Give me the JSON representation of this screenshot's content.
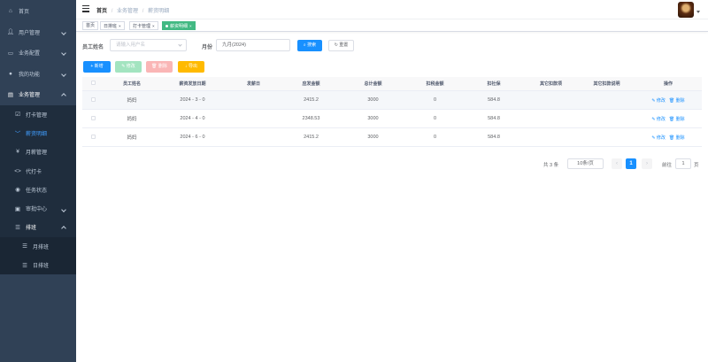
{
  "sidebar": {
    "items": [
      {
        "label": "首页",
        "icon": "dashboard-icon"
      },
      {
        "label": "用户管理",
        "icon": "user-icon"
      },
      {
        "label": "业务配置",
        "icon": "monitor-icon"
      },
      {
        "label": "我的功能",
        "icon": "person-icon"
      },
      {
        "label": "业务管理",
        "icon": "business-icon"
      }
    ],
    "sub": [
      {
        "label": "打卡管理",
        "icon": "checkbox-icon"
      },
      {
        "label": "薪资明细",
        "icon": "chevron-icon"
      },
      {
        "label": "月薪管理",
        "icon": "yen-icon"
      },
      {
        "label": "代打卡",
        "icon": "code-icon"
      },
      {
        "label": "任务状态",
        "icon": "eye-icon"
      },
      {
        "label": "审批中心",
        "icon": "approval-icon"
      },
      {
        "label": "排班",
        "icon": "list-icon"
      }
    ],
    "sub2": [
      {
        "label": "月排班",
        "icon": "list-icon"
      },
      {
        "label": "日排班",
        "icon": "list-icon"
      }
    ]
  },
  "breadcrumb": {
    "home": "首页",
    "sep": "/",
    "level1": "业务管理",
    "level2": "薪资明细"
  },
  "tags": {
    "t1": "首页",
    "t2": "日排班",
    "t3": "打卡管理",
    "t4": "薪资明细",
    "close": "×"
  },
  "search": {
    "name_label": "员工姓名",
    "name_placeholder": "请输入用户名",
    "month_label": "月份",
    "month_value": "九月(2024)",
    "search_btn": "搜索",
    "reset_btn": "重置"
  },
  "toolbar": {
    "add": "新增",
    "edit": "修改",
    "delete": "删除",
    "export": "导出"
  },
  "table": {
    "headers": [
      "员工姓名",
      "薪资发放日期",
      "发薪日",
      "应发金额",
      "总计金额",
      "扣税金额",
      "扣社保",
      "其它扣款项",
      "其它扣款说明",
      "操作"
    ],
    "rows": [
      {
        "name": "妈妈",
        "date": "2024 - 3 - 0",
        "payday": "",
        "due": "2415.2",
        "total": "3000",
        "tax": "0",
        "social": "584.8",
        "other": "",
        "note": ""
      },
      {
        "name": "妈妈",
        "date": "2024 - 4 - 0",
        "payday": "",
        "due": "2348.53",
        "total": "3000",
        "tax": "0",
        "social": "584.8",
        "other": "",
        "note": ""
      },
      {
        "name": "妈妈",
        "date": "2024 - 6 - 0",
        "payday": "",
        "due": "2415.2",
        "total": "3000",
        "tax": "0",
        "social": "584.8",
        "other": "",
        "note": ""
      }
    ],
    "edit_link": "修改",
    "delete_link": "删除"
  },
  "pagination": {
    "total": "共 3 条",
    "page_size": "10条/页",
    "prev": "‹",
    "current": "1",
    "next": "›",
    "goto": "前往",
    "goto_value": "1",
    "unit": "页"
  },
  "colors": {
    "sidebar": "#304156",
    "primary": "#1890ff",
    "tag_active": "#42b983"
  }
}
